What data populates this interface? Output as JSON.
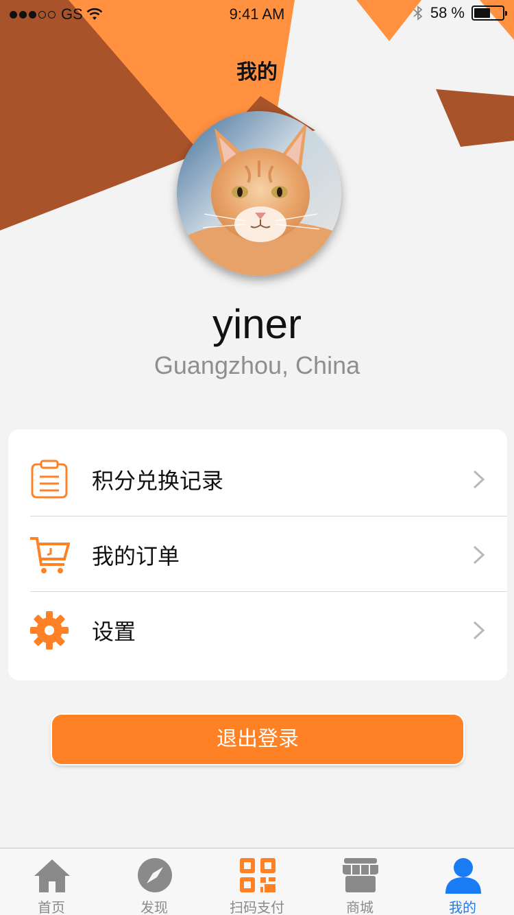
{
  "status_bar": {
    "carrier": "GS",
    "time": "9:41 AM",
    "battery": "58 %",
    "battery_level": 0.58,
    "signal_bars_filled": 3,
    "signal_bars_total": 5
  },
  "header": {
    "title": "我的"
  },
  "profile": {
    "username": "yiner",
    "location": "Guangzhou, China"
  },
  "menu": {
    "items": [
      {
        "label": "积分兑换记录",
        "icon": "clipboard-icon"
      },
      {
        "label": "我的订单",
        "icon": "shopping-cart-icon"
      },
      {
        "label": "设置",
        "icon": "gear-icon"
      }
    ]
  },
  "logout": {
    "label": "退出登录"
  },
  "tabbar": {
    "tabs": [
      {
        "label": "首页",
        "icon": "home-icon"
      },
      {
        "label": "发现",
        "icon": "compass-icon"
      },
      {
        "label": "扫码支付",
        "icon": "qr-code-icon"
      },
      {
        "label": "商城",
        "icon": "store-icon"
      },
      {
        "label": "我的",
        "icon": "user-icon"
      }
    ],
    "active_index": 4
  },
  "colors": {
    "accent": "#ff8125",
    "active_tab": "#1a7cf5",
    "inactive_tab": "#8a8a8a",
    "shape_dark": "#a9532a",
    "shape_light": "#ff9141"
  }
}
